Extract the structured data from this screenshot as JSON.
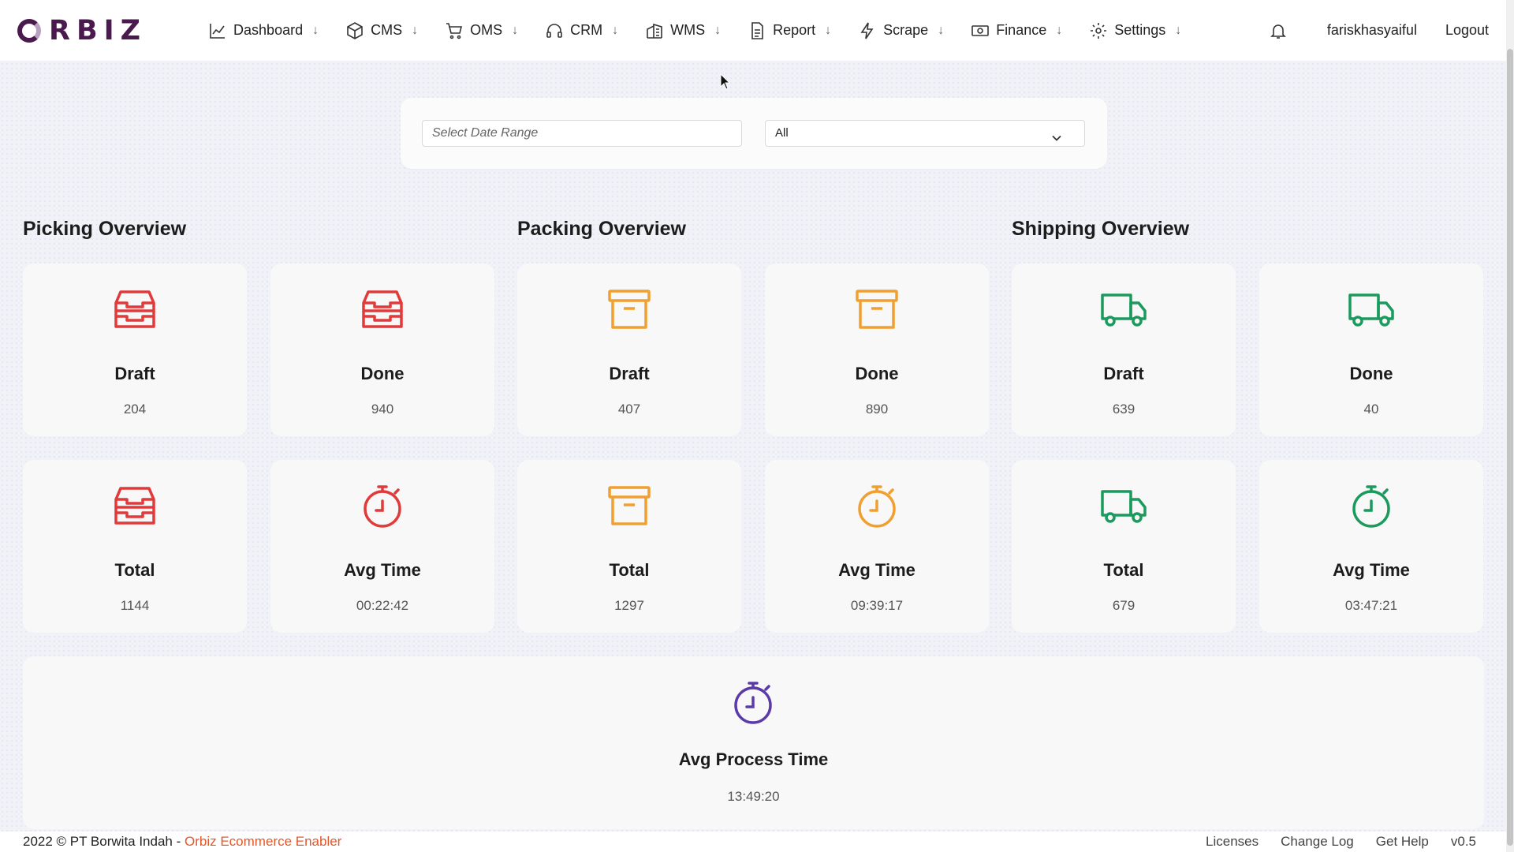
{
  "brand": {
    "logo_text": "RBIZ"
  },
  "nav": {
    "items": [
      {
        "label": "Dashboard",
        "icon": "chart-line-icon"
      },
      {
        "label": "CMS",
        "icon": "cube-icon"
      },
      {
        "label": "OMS",
        "icon": "cart-icon"
      },
      {
        "label": "CRM",
        "icon": "headset-icon"
      },
      {
        "label": "WMS",
        "icon": "warehouse-icon"
      },
      {
        "label": "Report",
        "icon": "document-icon"
      },
      {
        "label": "Scrape",
        "icon": "bolt-icon"
      },
      {
        "label": "Finance",
        "icon": "money-icon"
      },
      {
        "label": "Settings",
        "icon": "gear-icon"
      }
    ],
    "dropdown_arrow": "↓",
    "username": "fariskhasyaiful",
    "logout_label": "Logout"
  },
  "filter": {
    "date_placeholder": "Select Date Range",
    "select_value": "All"
  },
  "sections": {
    "picking_title": "Picking Overview",
    "packing_title": "Packing Overview",
    "shipping_title": "Shipping Overview"
  },
  "colors": {
    "picking": "#e03a3a",
    "packing": "#f0a030",
    "shipping": "#1a9a5c",
    "process": "#5b3aa8",
    "footer_brand": "#e2572b"
  },
  "cards": {
    "picking_draft": {
      "label": "Draft",
      "value": "204"
    },
    "picking_done": {
      "label": "Done",
      "value": "940"
    },
    "packing_draft": {
      "label": "Draft",
      "value": "407"
    },
    "packing_done": {
      "label": "Done",
      "value": "890"
    },
    "shipping_draft": {
      "label": "Draft",
      "value": "639"
    },
    "shipping_done": {
      "label": "Done",
      "value": "40"
    },
    "picking_total": {
      "label": "Total",
      "value": "1144"
    },
    "picking_avg": {
      "label": "Avg Time",
      "value": "00:22:42"
    },
    "packing_total": {
      "label": "Total",
      "value": "1297"
    },
    "packing_avg": {
      "label": "Avg Time",
      "value": "09:39:17"
    },
    "shipping_total": {
      "label": "Total",
      "value": "679"
    },
    "shipping_avg": {
      "label": "Avg Time",
      "value": "03:47:21"
    },
    "process_avg": {
      "label": "Avg Process Time",
      "value": "13:49:20"
    }
  },
  "footer": {
    "copyright": "2022 © PT Borwita Indah - ",
    "brand": "Orbiz Ecommerce Enabler",
    "links": [
      "Licenses",
      "Change Log",
      "Get Help",
      "v0.5"
    ]
  }
}
